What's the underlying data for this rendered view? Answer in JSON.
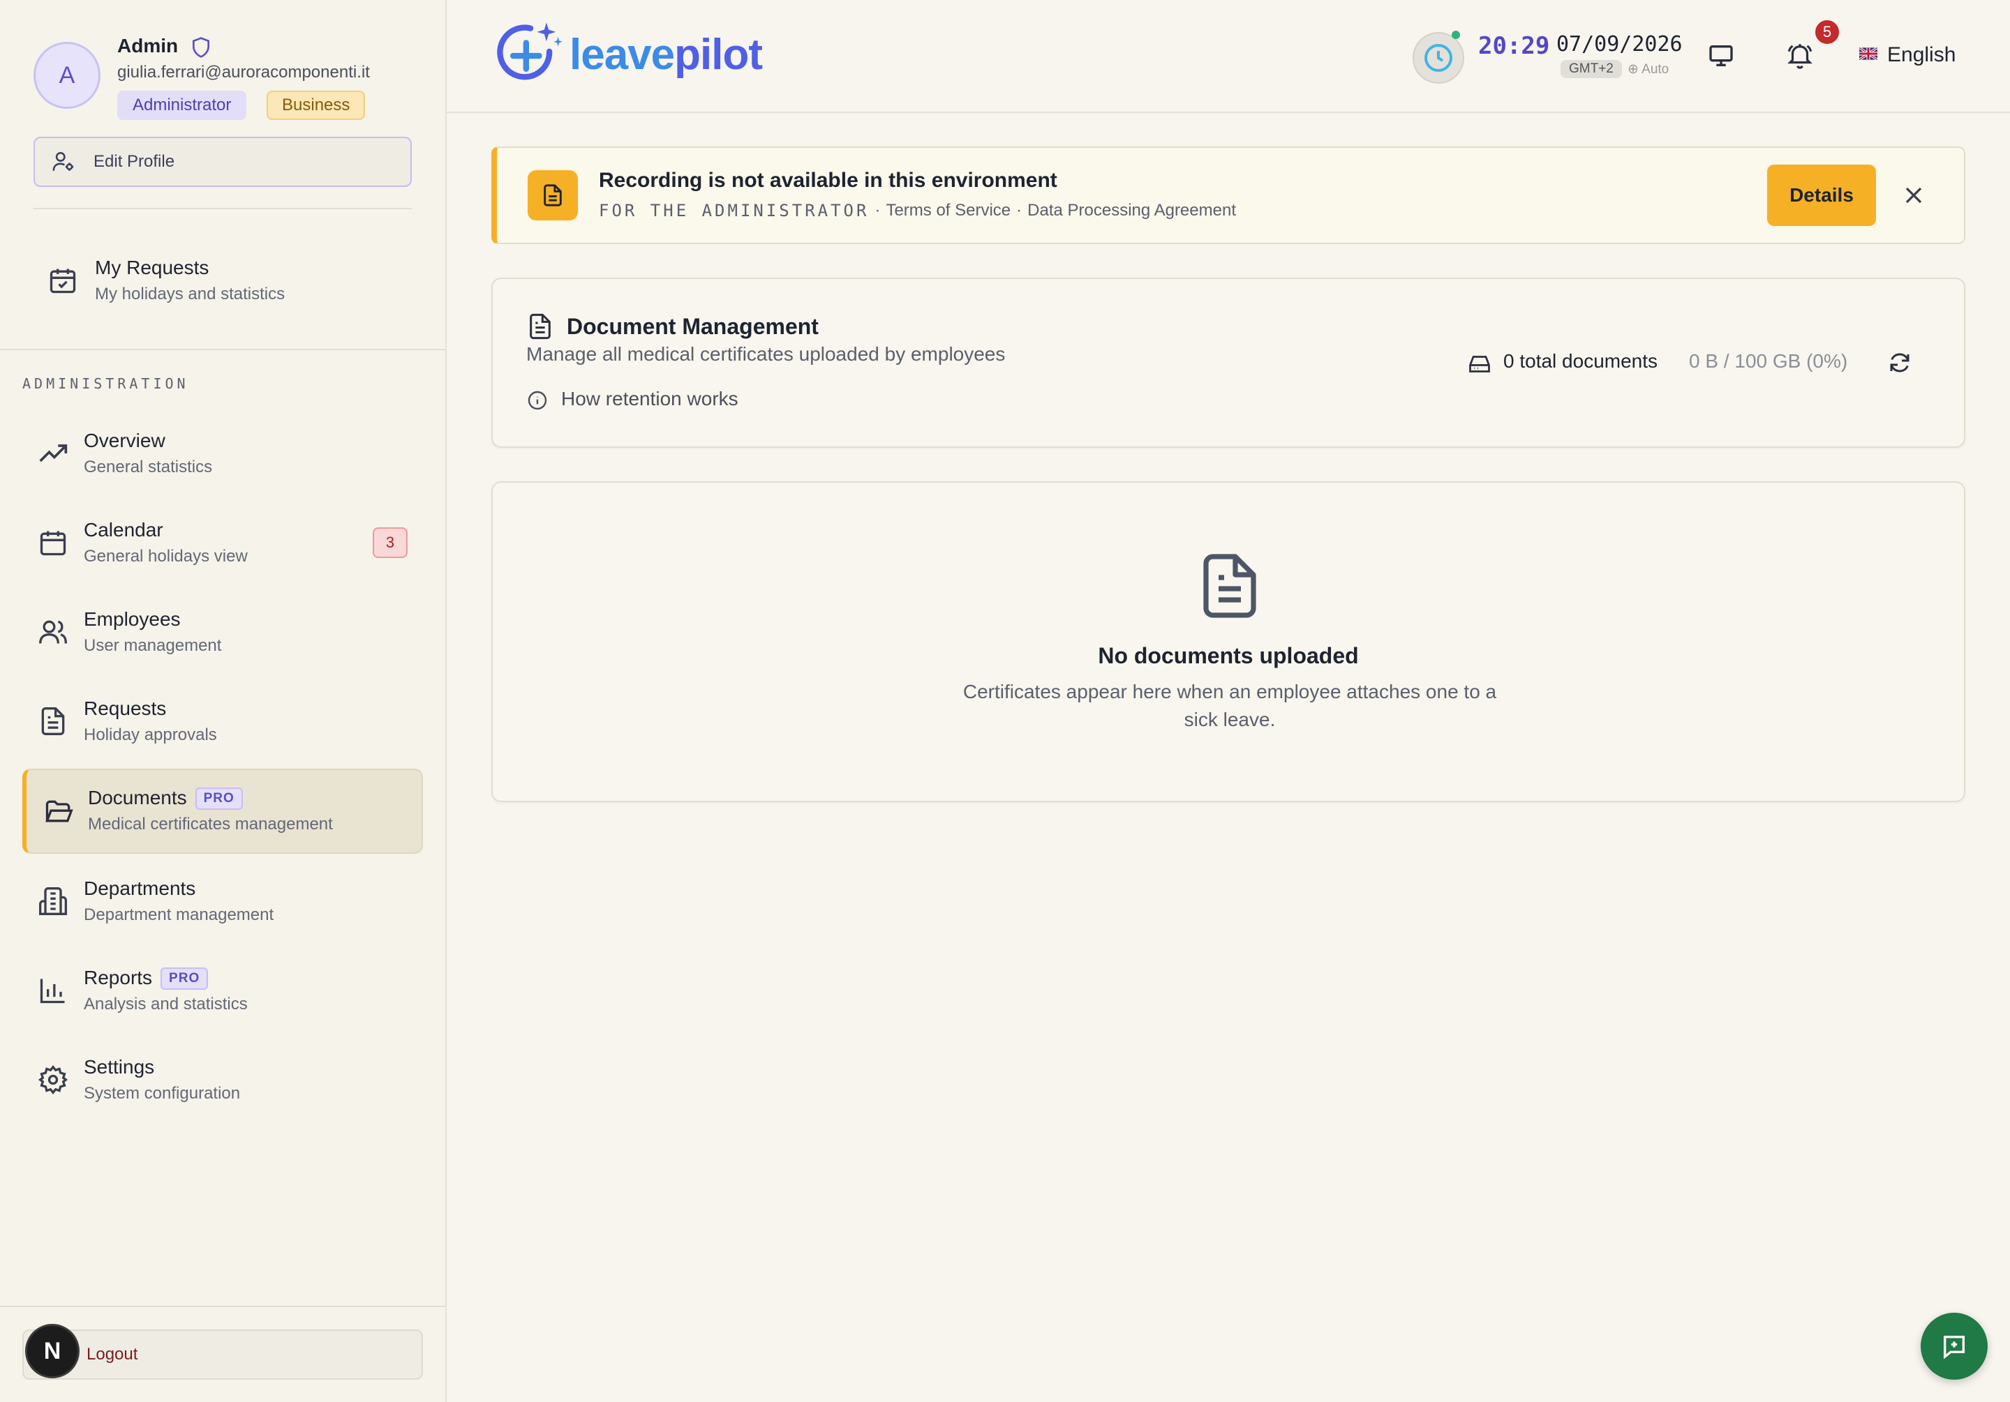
{
  "user": {
    "initial": "A",
    "name": "Admin",
    "email": "giulia.ferrari@auroracomponenti.it",
    "role": "Administrator",
    "plan": "Business",
    "edit_profile_label": "Edit Profile"
  },
  "sidebar": {
    "my_requests": {
      "title": "My Requests",
      "subtitle": "My holidays and statistics"
    },
    "section_label": "ADMINISTRATION",
    "items": [
      {
        "title": "Overview",
        "subtitle": "General statistics"
      },
      {
        "title": "Calendar",
        "subtitle": "General holidays view",
        "badge": "3"
      },
      {
        "title": "Employees",
        "subtitle": "User management"
      },
      {
        "title": "Requests",
        "subtitle": "Holiday approvals"
      },
      {
        "title": "Documents",
        "subtitle": "Medical certificates management",
        "pro": "PRO",
        "active": true
      },
      {
        "title": "Departments",
        "subtitle": "Department management"
      },
      {
        "title": "Reports",
        "subtitle": "Analysis and statistics",
        "pro": "PRO"
      },
      {
        "title": "Settings",
        "subtitle": "System configuration"
      }
    ],
    "logout_label": "Logout",
    "dev_badge": "N"
  },
  "header": {
    "logo_part1": "leave",
    "logo_part2": "pilot",
    "time": "20:29",
    "date": "07/09/2026",
    "timezone": "GMT+2",
    "tz_mode": "⊕ Auto",
    "notifications_count": "5",
    "language": "English"
  },
  "banner": {
    "title": "Recording is not available in this environment",
    "audience": "FOR THE ADMINISTRATOR",
    "sep": "·",
    "link1": "Terms of Service",
    "link2": "Data Processing Agreement",
    "details_label": "Details"
  },
  "documents": {
    "title": "Document Management",
    "subtitle": "Manage all medical certificates uploaded by employees",
    "retention_link": "How retention works",
    "total_docs": "0 total documents",
    "storage": "0 B / 100 GB (0%)"
  },
  "empty_state": {
    "title": "No documents uploaded",
    "description": "Certificates appear here when an employee attaches one to a sick leave."
  },
  "colors": {
    "accent": "#f5b025",
    "brand": "#4f5fe6",
    "fab": "#1f7a45",
    "danger": "#c42b2b"
  }
}
